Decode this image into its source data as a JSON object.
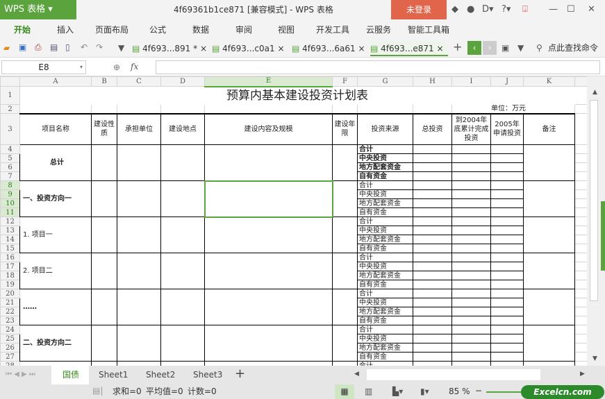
{
  "app": {
    "logo": "WPS 表格",
    "title": "4f69361b1ce871 [兼容模式] - WPS 表格",
    "login": "未登录"
  },
  "menu": [
    "开始",
    "插入",
    "页面布局",
    "公式",
    "数据",
    "审阅",
    "视图",
    "开发工具",
    "云服务",
    "智能工具箱"
  ],
  "doc_tabs": [
    {
      "label": "4f693...891 *",
      "active": false
    },
    {
      "label": "4f693...c0a1",
      "active": false
    },
    {
      "label": "4f693...6a61",
      "active": false
    },
    {
      "label": "4f693...e871",
      "active": true
    }
  ],
  "search_label": "点此查找命令",
  "formula": {
    "cell_ref": "E8",
    "fx": "fx",
    "value": ""
  },
  "columns": [
    "A",
    "B",
    "C",
    "D",
    "E",
    "F",
    "G",
    "H",
    "I",
    "J",
    "K"
  ],
  "selected_column": "E",
  "sheet": {
    "title": "预算内基本建设投资计划表",
    "unit": "单位：万元",
    "headers": [
      "项目名称",
      "建设性质",
      "承担单位",
      "建设地点",
      "建设内容及规模",
      "建设年限",
      "投资来源",
      "总投资",
      "到2004年底累计完成投资",
      "2005年申请投资",
      "备注"
    ],
    "sources": [
      "合计",
      "中央投资",
      "地方配套资金",
      "自有资金"
    ],
    "groups": [
      {
        "name": "总计",
        "bold": true
      },
      {
        "name": "一、投资方向一",
        "bold": true
      },
      {
        "name": "1. 项目一",
        "bold": false
      },
      {
        "name": "2. 项目二",
        "bold": false
      },
      {
        "name": "……",
        "bold": true
      },
      {
        "name": "二、投资方向二",
        "bold": true
      }
    ],
    "row28_source": "合计"
  },
  "sheet_tabs": [
    {
      "label": "国债",
      "active": true
    },
    {
      "label": "Sheet1"
    },
    {
      "label": "Sheet2"
    },
    {
      "label": "Sheet3"
    }
  ],
  "status": {
    "sum": "求和=0",
    "avg": "平均值=0",
    "count": "计数=0",
    "zoom": "85 %",
    "watermark": "Excelcn.com"
  }
}
